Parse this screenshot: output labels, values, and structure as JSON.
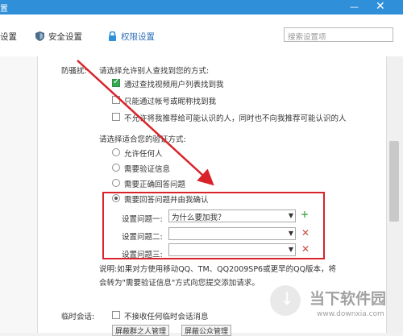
{
  "window": {
    "title": "置",
    "minimize_glyph": "—",
    "close_glyph": "✕"
  },
  "tabs": [
    {
      "label": "设置",
      "icon": "settings-icon"
    },
    {
      "label": "安全设置",
      "icon": "shield-icon"
    },
    {
      "label": "权限设置",
      "icon": "lock-icon"
    }
  ],
  "search": {
    "placeholder": "搜索设置项"
  },
  "harass": {
    "section_label": "防骚扰:",
    "prompt": "请选择允许别人查找到您的方式:",
    "options": [
      {
        "label": "通过查找视频用户列表找到我",
        "checked": true
      },
      {
        "label": "只能通过帐号或昵称找到我",
        "checked": false
      },
      {
        "label": "不允许将我推荐给可能认识的人，同时也不向我推荐可能认识的人",
        "checked": false
      }
    ]
  },
  "verify": {
    "prompt": "请选择适合您的验证方式:",
    "options": [
      {
        "label": "允许任何人",
        "selected": false
      },
      {
        "label": "需要验证信息",
        "selected": false
      },
      {
        "label": "需要正确回答问题",
        "selected": false
      },
      {
        "label": "需要回答问题并由我确认",
        "selected": true
      }
    ],
    "questions": [
      {
        "label": "设置问题一:",
        "value": "为什么要加我？",
        "action": "+"
      },
      {
        "label": "设置问题二:",
        "value": "",
        "action": "✕"
      },
      {
        "label": "设置问题三:",
        "value": "",
        "action": "✕"
      }
    ],
    "note": "说明:如果对方使用移动QQ、TM、QQ2009SP6或更早的QQ版本，将",
    "note2": "会转为\"需要验证信息\"方式向您提交添加请求。"
  },
  "temp_chat": {
    "label": "临时会话:",
    "option": "不接收任何临时会话消息",
    "buttons": [
      "屏蔽群之人管理",
      "屏蔽公众管理"
    ]
  },
  "watermark": {
    "text": "当下软件园",
    "url": "www.downxia.com"
  },
  "colors": {
    "accent": "#2f8fd8",
    "highlight_box": "#d9232a",
    "arrow": "#d9232a",
    "check_green": "#36a852"
  }
}
